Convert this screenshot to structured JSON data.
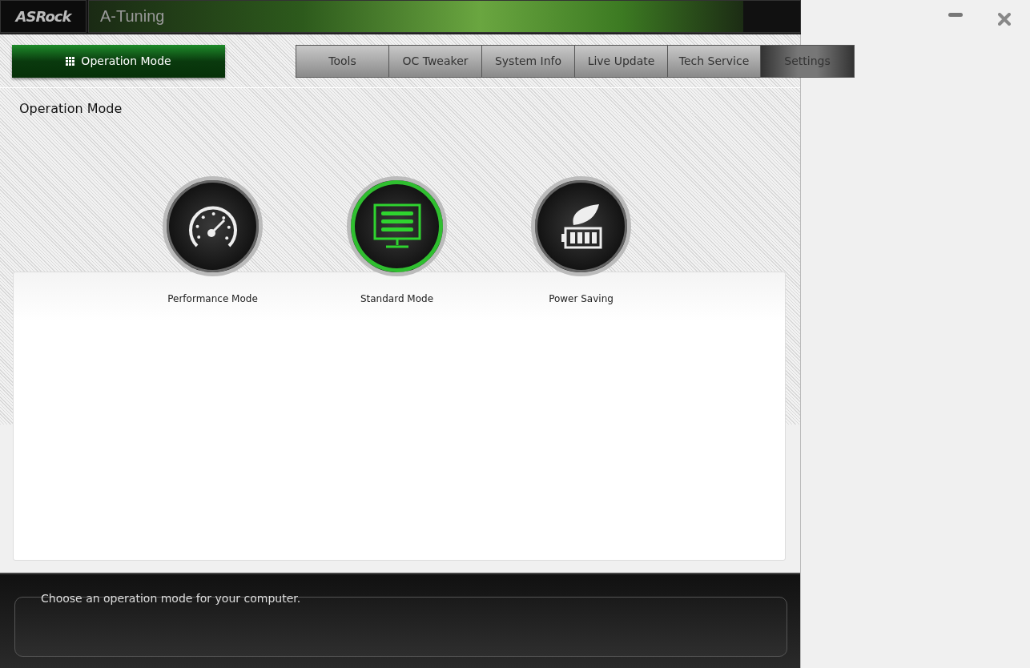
{
  "header": {
    "logo": "ASRock",
    "app_name": "A-Tuning"
  },
  "nav_button": {
    "label": "Operation Mode",
    "selected": true
  },
  "tabs": [
    {
      "label": "Tools",
      "selected": false
    },
    {
      "label": "OC Tweaker",
      "selected": false
    },
    {
      "label": "System Info",
      "selected": false
    },
    {
      "label": "Live Update",
      "selected": false
    },
    {
      "label": "Tech Service",
      "selected": false
    },
    {
      "label": "Settings",
      "selected": true
    }
  ],
  "section_title": "Operation Mode",
  "modes": [
    {
      "kind": "performance",
      "label": "Performance Mode",
      "selected": false
    },
    {
      "kind": "standard",
      "label": "Standard Mode",
      "selected": true
    },
    {
      "kind": "power",
      "label": "Power Saving",
      "selected": false
    }
  ],
  "description": "Choose an operation mode for your computer."
}
